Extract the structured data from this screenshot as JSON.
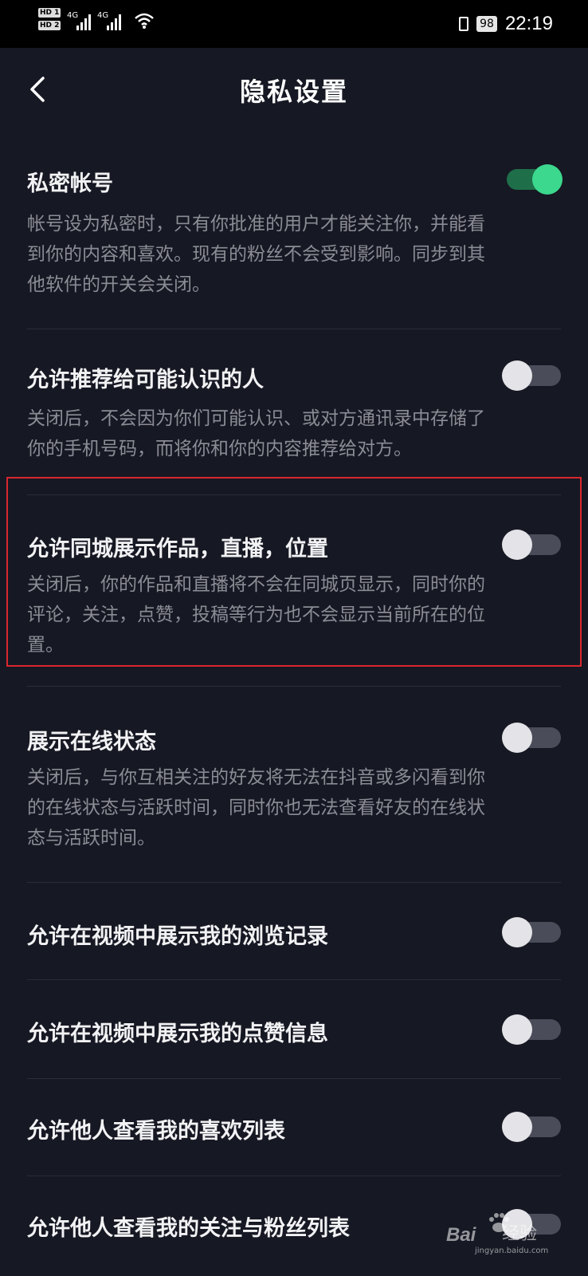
{
  "status_bar": {
    "sim1": "HD 1",
    "sim2": "HD 2",
    "network1": "4G",
    "network2": "4G",
    "battery": "98",
    "time": "22:19"
  },
  "header": {
    "title": "隐私设置",
    "back_icon": "chevron-left-icon"
  },
  "settings": [
    {
      "title": "私密帐号",
      "on": true,
      "desc_lines": [
        "帐号设为私密时，只有你批准的用户才能关注你，并能看",
        "到你的内容和喜欢。现有的粉丝不会受到影响。同步到其",
        "他软件的开关会关闭。"
      ]
    },
    {
      "title": "允许推荐给可能认识的人",
      "on": false,
      "desc_lines": [
        "关闭后，不会因为你们可能认识、或对方通讯录中存储了",
        "你的手机号码，而将你和你的内容推荐给对方。"
      ]
    },
    {
      "title": "允许同城展示作品，直播，位置",
      "on": false,
      "desc_lines": [
        "关闭后，你的作品和直播将不会在同城页显示，同时你的",
        "评论，关注，点赞，投稿等行为也不会显示当前所在的位",
        "置。"
      ]
    },
    {
      "title": "展示在线状态",
      "on": false,
      "desc_lines": [
        "关闭后，与你互相关注的好友将无法在抖音或多闪看到你",
        "的在线状态与活跃时间，同时你也无法查看好友的在线状",
        "态与活跃时间。"
      ]
    },
    {
      "title": "允许在视频中展示我的浏览记录",
      "on": false,
      "desc_lines": []
    },
    {
      "title": "允许在视频中展示我的点赞信息",
      "on": false,
      "desc_lines": []
    },
    {
      "title": "允许他人查看我的喜欢列表",
      "on": false,
      "desc_lines": []
    },
    {
      "title": "允许他人查看我的关注与粉丝列表",
      "on": false,
      "desc_lines": []
    }
  ],
  "watermark": {
    "brand_left": "Bai",
    "brand_right": "经验",
    "site": "jingyan.baidu.com"
  },
  "colors": {
    "background": "#161823",
    "toggle_on": "#3bd88d",
    "highlight_border": "#d9272e"
  }
}
